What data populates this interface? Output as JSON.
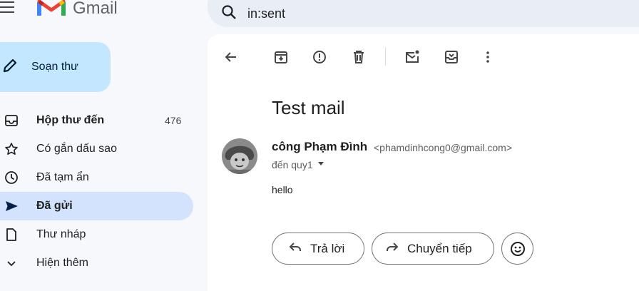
{
  "header": {
    "app_name": "Gmail",
    "search_value": "in:sent"
  },
  "sidebar": {
    "compose_label": "Soạn thư",
    "items": [
      {
        "label": "Hộp thư đến",
        "count": "476",
        "icon": "inbox-icon"
      },
      {
        "label": "Có gắn dấu sao",
        "icon": "star-icon"
      },
      {
        "label": "Đã tạm ẩn",
        "icon": "clock-icon"
      },
      {
        "label": "Đã gửi",
        "icon": "send-icon",
        "active": true
      },
      {
        "label": "Thư nháp",
        "icon": "draft-icon"
      },
      {
        "label": "Hiện thêm",
        "icon": "chevron-down-icon"
      }
    ]
  },
  "message": {
    "subject": "Test mail",
    "sender_name": "công Phạm Đình",
    "sender_email": "<phamdinhcong0@gmail.com>",
    "recipient": "đến quy1",
    "body": "hello"
  },
  "actions": {
    "reply_label": "Trả lời",
    "forward_label": "Chuyển tiếp"
  },
  "colors": {
    "background": "#f6f8fc",
    "compose": "#c2e7ff",
    "active_nav": "#d3e3fd",
    "search": "#e9eef6"
  }
}
